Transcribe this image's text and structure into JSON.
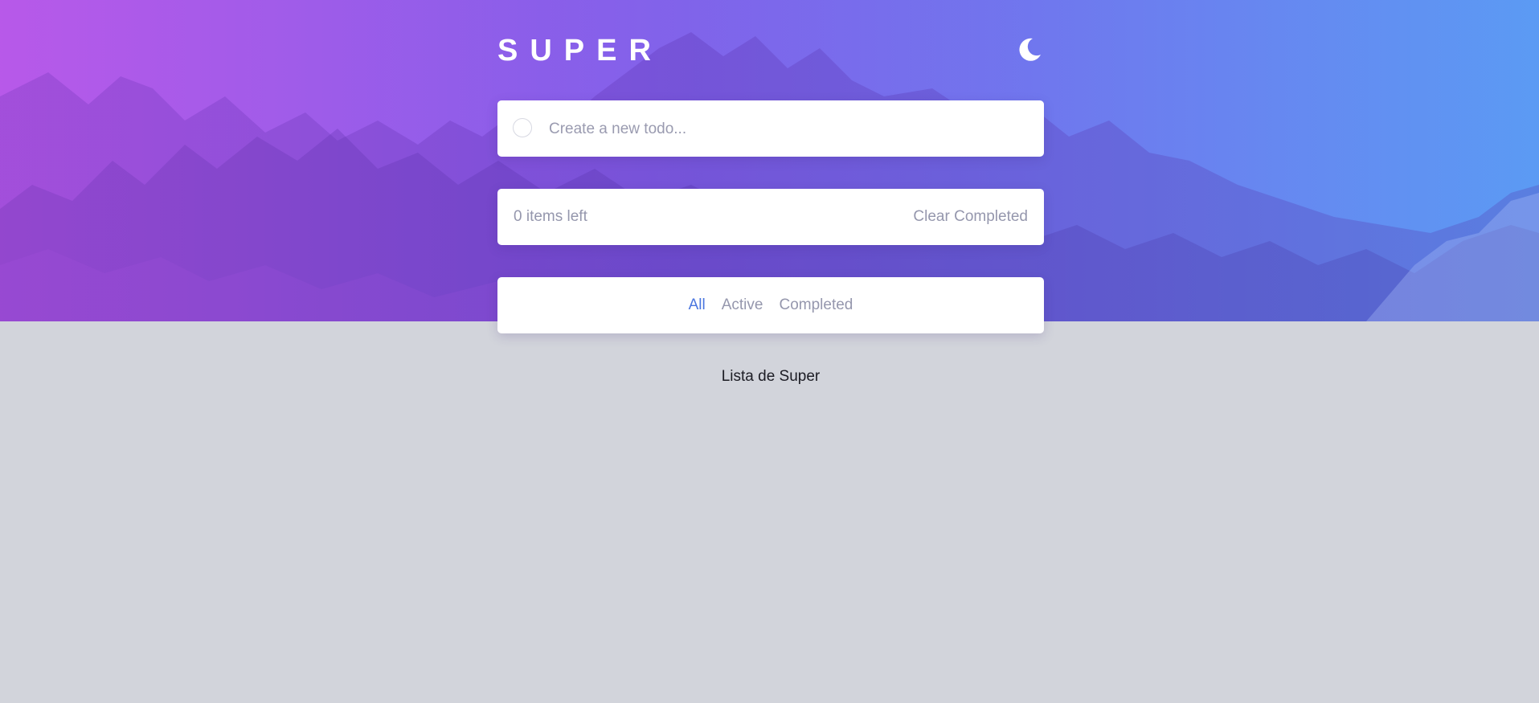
{
  "app": {
    "title": "SUPER",
    "theme_icon": "moon-icon"
  },
  "new_todo": {
    "placeholder": "Create a new todo..."
  },
  "footer": {
    "items_left": "0 items left",
    "clear_label": "Clear Completed"
  },
  "filters": {
    "all": "All",
    "active": "Active",
    "completed": "Completed",
    "selected": "All"
  },
  "caption": "Lista de Super",
  "colors": {
    "accent": "#4a76df",
    "muted_text": "#9597ad",
    "background": "#d2d4db",
    "card": "#ffffff",
    "hero_left": "#b45ee8",
    "hero_right": "#5f9cf3"
  }
}
